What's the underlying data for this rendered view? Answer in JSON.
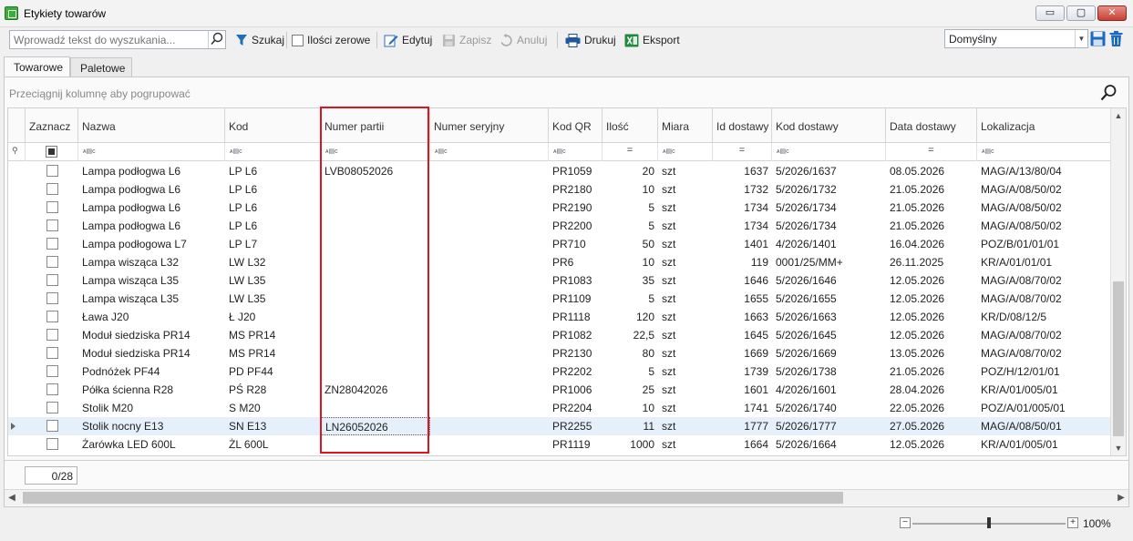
{
  "window": {
    "title": "Etykiety towarów",
    "minimize": "▭",
    "restore": "▢",
    "close": "✕"
  },
  "toolbar": {
    "search_placeholder": "Wprowadź tekst do wyszukania...",
    "search_label": "Szukaj",
    "zero_qty_label": "Ilości zerowe",
    "edit_label": "Edytuj",
    "save_label": "Zapisz",
    "cancel_label": "Anuluj",
    "print_label": "Drukuj",
    "export_label": "Eksport",
    "layout_value": "Domyślny"
  },
  "tabs": [
    {
      "label": "Towarowe"
    },
    {
      "label": "Paletowe"
    }
  ],
  "group_hint": "Przeciągnij kolumnę aby pogrupować",
  "columns": [
    "Zaznacz",
    "Nazwa",
    "Kod",
    "Numer partii",
    "Numer seryjny",
    "Kod QR",
    "Ilość",
    "Miara",
    "Id dostawy",
    "Kod dostawy",
    "Data dostawy",
    "Lokalizacja"
  ],
  "filter_row": {
    "text_op": "ᴀ▤c",
    "num_op": "="
  },
  "rows": [
    {
      "name": "Lampa podłogwa L6",
      "code": "LP L6",
      "batch": "LVB08052026",
      "serial": "",
      "qr": "PR1059",
      "qty": "20",
      "unit": "szt",
      "delivery_id": "1637",
      "delivery_code": "5/2026/1637",
      "delivery_date": "08.05.2026",
      "location": "MAG/A/13/80/04"
    },
    {
      "name": "Lampa podłogwa L6",
      "code": "LP L6",
      "batch": "",
      "serial": "",
      "qr": "PR2180",
      "qty": "10",
      "unit": "szt",
      "delivery_id": "1732",
      "delivery_code": "5/2026/1732",
      "delivery_date": "21.05.2026",
      "location": "MAG/A/08/50/02"
    },
    {
      "name": "Lampa podłogwa L6",
      "code": "LP L6",
      "batch": "",
      "serial": "",
      "qr": "PR2190",
      "qty": "5",
      "unit": "szt",
      "delivery_id": "1734",
      "delivery_code": "5/2026/1734",
      "delivery_date": "21.05.2026",
      "location": "MAG/A/08/50/02"
    },
    {
      "name": "Lampa podłogwa L6",
      "code": "LP L6",
      "batch": "",
      "serial": "",
      "qr": "PR2200",
      "qty": "5",
      "unit": "szt",
      "delivery_id": "1734",
      "delivery_code": "5/2026/1734",
      "delivery_date": "21.05.2026",
      "location": "MAG/A/08/50/02"
    },
    {
      "name": "Lampa podłogowa L7",
      "code": "LP L7",
      "batch": "",
      "serial": "",
      "qr": "PR710",
      "qty": "50",
      "unit": "szt",
      "delivery_id": "1401",
      "delivery_code": "4/2026/1401",
      "delivery_date": "16.04.2026",
      "location": "POZ/B/01/01/01"
    },
    {
      "name": "Lampa wisząca L32",
      "code": "LW L32",
      "batch": "",
      "serial": "",
      "qr": "PR6",
      "qty": "10",
      "unit": "szt",
      "delivery_id": "119",
      "delivery_code": "0001/25/MM+",
      "delivery_date": "26.11.2025",
      "location": "KR/A/01/01/01"
    },
    {
      "name": "Lampa wisząca L35",
      "code": "LW L35",
      "batch": "",
      "serial": "",
      "qr": "PR1083",
      "qty": "35",
      "unit": "szt",
      "delivery_id": "1646",
      "delivery_code": "5/2026/1646",
      "delivery_date": "12.05.2026",
      "location": "MAG/A/08/70/02"
    },
    {
      "name": "Lampa wisząca L35",
      "code": "LW L35",
      "batch": "",
      "serial": "",
      "qr": "PR1109",
      "qty": "5",
      "unit": "szt",
      "delivery_id": "1655",
      "delivery_code": "5/2026/1655",
      "delivery_date": "12.05.2026",
      "location": "MAG/A/08/70/02"
    },
    {
      "name": "Ława J20",
      "code": "Ł J20",
      "batch": "",
      "serial": "",
      "qr": "PR1118",
      "qty": "120",
      "unit": "szt",
      "delivery_id": "1663",
      "delivery_code": "5/2026/1663",
      "delivery_date": "12.05.2026",
      "location": "KR/D/08/12/5"
    },
    {
      "name": "Moduł siedziska PR14",
      "code": "MS PR14",
      "batch": "",
      "serial": "",
      "qr": "PR1082",
      "qty": "22,5",
      "unit": "szt",
      "delivery_id": "1645",
      "delivery_code": "5/2026/1645",
      "delivery_date": "12.05.2026",
      "location": "MAG/A/08/70/02"
    },
    {
      "name": "Moduł siedziska PR14",
      "code": "MS PR14",
      "batch": "",
      "serial": "",
      "qr": "PR2130",
      "qty": "80",
      "unit": "szt",
      "delivery_id": "1669",
      "delivery_code": "5/2026/1669",
      "delivery_date": "13.05.2026",
      "location": "MAG/A/08/70/02"
    },
    {
      "name": "Podnóżek PF44",
      "code": "PD PF44",
      "batch": "",
      "serial": "",
      "qr": "PR2202",
      "qty": "5",
      "unit": "szt",
      "delivery_id": "1739",
      "delivery_code": "5/2026/1738",
      "delivery_date": "21.05.2026",
      "location": "POZ/H/12/01/01"
    },
    {
      "name": "Półka ścienna R28",
      "code": "PŚ R28",
      "batch": "ZN28042026",
      "serial": "",
      "qr": "PR1006",
      "qty": "25",
      "unit": "szt",
      "delivery_id": "1601",
      "delivery_code": "4/2026/1601",
      "delivery_date": "28.04.2026",
      "location": "KR/A/01/005/01"
    },
    {
      "name": "Stolik M20",
      "code": "S M20",
      "batch": "",
      "serial": "",
      "qr": "PR2204",
      "qty": "10",
      "unit": "szt",
      "delivery_id": "1741",
      "delivery_code": "5/2026/1740",
      "delivery_date": "22.05.2026",
      "location": "POZ/A/01/005/01"
    },
    {
      "name": "Stolik nocny E13",
      "code": "SN E13",
      "batch": "LN26052026",
      "serial": "",
      "qr": "PR2255",
      "qty": "11",
      "unit": "szt",
      "delivery_id": "1777",
      "delivery_code": "5/2026/1777",
      "delivery_date": "27.05.2026",
      "location": "MAG/A/08/50/01"
    },
    {
      "name": "Żarówka LED 600L",
      "code": "ŻL 600L",
      "batch": "",
      "serial": "",
      "qr": "PR1119",
      "qty": "1000",
      "unit": "szt",
      "delivery_id": "1664",
      "delivery_code": "5/2026/1664",
      "delivery_date": "12.05.2026",
      "location": "KR/A/01/005/01"
    }
  ],
  "selected_row": 14,
  "footer": {
    "counter": "0/28"
  },
  "status": {
    "zoom": "100%",
    "zoom_minus": "−",
    "zoom_plus": "+"
  }
}
